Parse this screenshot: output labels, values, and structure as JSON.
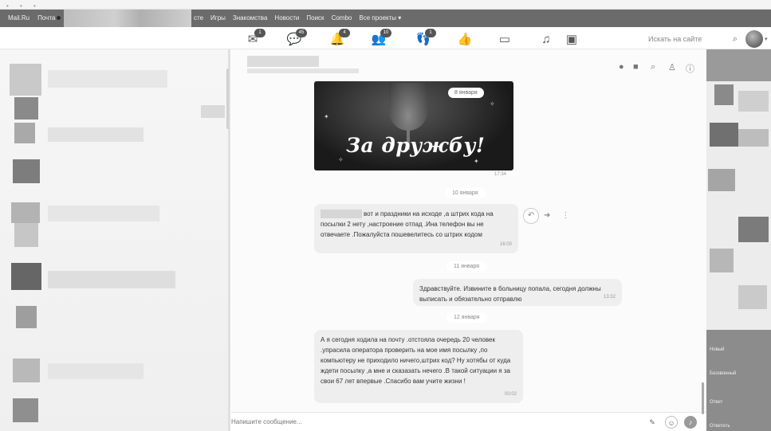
{
  "portal_bar": {
    "left_items": [
      "Mail.Ru",
      "Почта"
    ],
    "links": [
      "сте",
      "Игры",
      "Знакомства",
      "Новости",
      "Поиск",
      "Combo",
      "Все проекты ▾"
    ]
  },
  "header": {
    "icons": [
      {
        "name": "messages-icon",
        "glyph": "✉",
        "badge": "1"
      },
      {
        "name": "discussions-icon",
        "glyph": "💬",
        "badge": "45"
      },
      {
        "name": "notifications-icon",
        "glyph": "🔔",
        "badge": "4"
      },
      {
        "name": "friends-icon",
        "glyph": "👥",
        "badge": "10"
      },
      {
        "name": "guests-icon",
        "glyph": "👣",
        "badge": "1"
      },
      {
        "name": "events-icon",
        "glyph": "👍",
        "badge": ""
      },
      {
        "name": "video-icon",
        "glyph": "▭",
        "badge": ""
      },
      {
        "name": "music-icon",
        "glyph": "♫",
        "badge": ""
      },
      {
        "name": "games-icon",
        "glyph": "▣",
        "badge": ""
      }
    ],
    "search_placeholder": "Искать на сайте"
  },
  "chat": {
    "image_message": {
      "caption": "За дружбу!",
      "date_label": "8 января",
      "time": "17:34"
    },
    "messages": [
      {
        "date_separator": "10 января",
        "direction": "in",
        "text": "вот и праздники на исходе ,а штрих кода на посылки 2 нету ,настроение отпад .Ина телефон вы не отвечаете .Пожалуйста пошевелитесь со штрих кодом",
        "time": "16:00"
      },
      {
        "date_separator": "11 января",
        "direction": "out",
        "text": "Здравствуйте. Извините в больницу попала, сегодня должны выписать и обязательно отправлю",
        "time": "13:32"
      },
      {
        "date_separator": "12 января",
        "direction": "in",
        "text": "А я сегодня ходила на почту .отстояла очередь 20 человек .упрасила оператора проверить на мое имя посылку ,по компьютеру не приходило ничего,штрих код? Ну хотябы от куда ждети посылку ,а мне и сказазать нечего .В такой ситуации я за свои 67 лет впервые .Спасибо вам учите жизни !",
        "time": "00:02"
      }
    ],
    "composer_placeholder": "Напишите сообщение..."
  },
  "right_panel": {
    "labels": [
      "Новый",
      "Беззвонный",
      "Ответ",
      "Ответить"
    ]
  },
  "colors": {
    "portal_bar": "#6b6b6b",
    "bubble": "#eeeeee",
    "page": "#ffffff"
  }
}
